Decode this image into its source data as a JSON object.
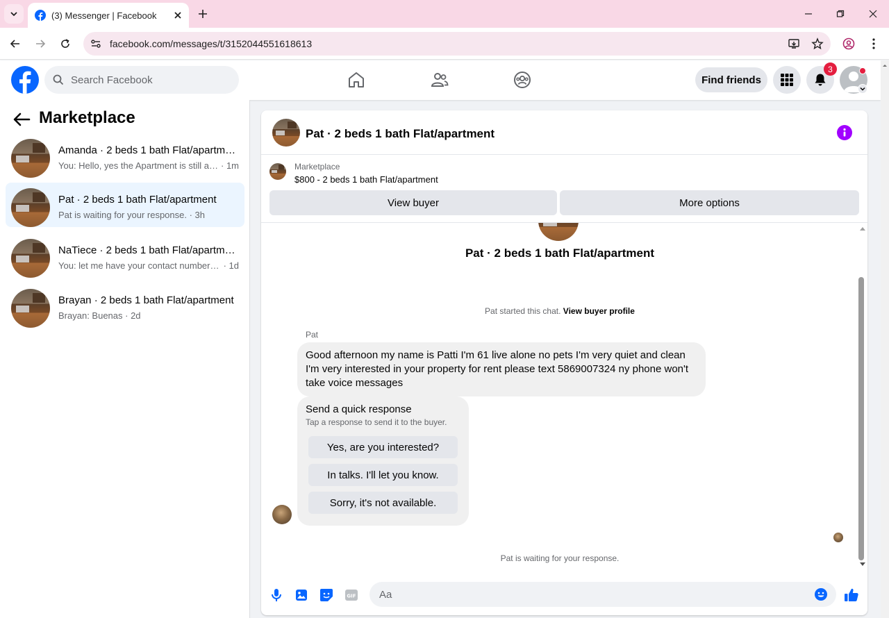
{
  "browser": {
    "tab_title": "(3) Messenger | Facebook",
    "url": "facebook.com/messages/t/3152044551618613"
  },
  "fb_header": {
    "search_placeholder": "Search Facebook",
    "find_friends_label": "Find friends",
    "notification_count": "3"
  },
  "left_panel": {
    "title": "Marketplace",
    "conversations": [
      {
        "name": "Amanda · 2 beds 1 bath Flat/apartment",
        "preview": "You: Hello, yes the Apartment is still available",
        "time": "1m",
        "active": false
      },
      {
        "name": "Pat · 2 beds 1 bath Flat/apartment",
        "preview": "Pat is waiting for your response.",
        "time": "3h",
        "active": true
      },
      {
        "name": "NaTiece · 2 beds 1 bath Flat/apartment",
        "preview": "You: let me have your contact number please",
        "time": "1d",
        "active": false
      },
      {
        "name": "Brayan · 2 beds 1 bath Flat/apartment",
        "preview": "Brayan: Buenas",
        "time": "2d",
        "active": false
      }
    ]
  },
  "chat": {
    "title": "Pat · 2 beds 1 bath Flat/apartment",
    "listing": {
      "source": "Marketplace",
      "title": "$800 - 2 beds 1 bath Flat/apartment",
      "view_buyer_label": "View buyer",
      "more_options_label": "More options"
    },
    "conversation_name": "Pat · 2 beds 1 bath Flat/apartment",
    "started_text": "Pat started this chat.",
    "view_buyer_profile_label": "View buyer profile",
    "sender_name": "Pat",
    "message": "Good afternoon my name is Patti I'm 61 live alone no pets I'm very quiet and clean I'm very interested in your property for rent  please text 5869007324 ny phone won't take voice messages",
    "quick_response": {
      "title": "Send a quick response",
      "subtitle": "Tap a response to send it to the buyer.",
      "options": [
        "Yes, are you interested?",
        "In talks. I'll let you know.",
        "Sorry, it's not available."
      ]
    },
    "waiting_text": "Pat is waiting for your response.",
    "composer_placeholder": "Aa"
  },
  "colors": {
    "fb_blue": "#0866ff",
    "active_conversation_bg": "#ebf5ff",
    "info_purple": "#a100ff",
    "badge_red": "#e41e3f",
    "tabbar_pink": "#f9d8e6"
  }
}
